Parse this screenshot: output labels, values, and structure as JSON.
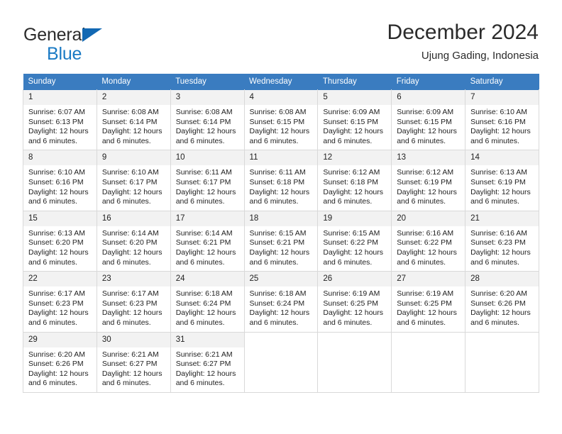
{
  "brand": {
    "line1": "General",
    "line2": "Blue",
    "triangle_color": "#1268b3",
    "blue_text_color": "#1a7ac4"
  },
  "header": {
    "title": "December 2024",
    "subtitle": "Ujung Gading, Indonesia"
  },
  "theme": {
    "header_blue": "#3a7cc0",
    "daynum_bg": "#f2f2f2",
    "grid_border": "#d9d9d9",
    "text": "#222222"
  },
  "columns": [
    "Sunday",
    "Monday",
    "Tuesday",
    "Wednesday",
    "Thursday",
    "Friday",
    "Saturday"
  ],
  "weeks": [
    [
      {
        "day": "1",
        "sunrise": "Sunrise: 6:07 AM",
        "sunset": "Sunset: 6:13 PM",
        "daylight1": "Daylight: 12 hours",
        "daylight2": "and 6 minutes."
      },
      {
        "day": "2",
        "sunrise": "Sunrise: 6:08 AM",
        "sunset": "Sunset: 6:14 PM",
        "daylight1": "Daylight: 12 hours",
        "daylight2": "and 6 minutes."
      },
      {
        "day": "3",
        "sunrise": "Sunrise: 6:08 AM",
        "sunset": "Sunset: 6:14 PM",
        "daylight1": "Daylight: 12 hours",
        "daylight2": "and 6 minutes."
      },
      {
        "day": "4",
        "sunrise": "Sunrise: 6:08 AM",
        "sunset": "Sunset: 6:15 PM",
        "daylight1": "Daylight: 12 hours",
        "daylight2": "and 6 minutes."
      },
      {
        "day": "5",
        "sunrise": "Sunrise: 6:09 AM",
        "sunset": "Sunset: 6:15 PM",
        "daylight1": "Daylight: 12 hours",
        "daylight2": "and 6 minutes."
      },
      {
        "day": "6",
        "sunrise": "Sunrise: 6:09 AM",
        "sunset": "Sunset: 6:15 PM",
        "daylight1": "Daylight: 12 hours",
        "daylight2": "and 6 minutes."
      },
      {
        "day": "7",
        "sunrise": "Sunrise: 6:10 AM",
        "sunset": "Sunset: 6:16 PM",
        "daylight1": "Daylight: 12 hours",
        "daylight2": "and 6 minutes."
      }
    ],
    [
      {
        "day": "8",
        "sunrise": "Sunrise: 6:10 AM",
        "sunset": "Sunset: 6:16 PM",
        "daylight1": "Daylight: 12 hours",
        "daylight2": "and 6 minutes."
      },
      {
        "day": "9",
        "sunrise": "Sunrise: 6:10 AM",
        "sunset": "Sunset: 6:17 PM",
        "daylight1": "Daylight: 12 hours",
        "daylight2": "and 6 minutes."
      },
      {
        "day": "10",
        "sunrise": "Sunrise: 6:11 AM",
        "sunset": "Sunset: 6:17 PM",
        "daylight1": "Daylight: 12 hours",
        "daylight2": "and 6 minutes."
      },
      {
        "day": "11",
        "sunrise": "Sunrise: 6:11 AM",
        "sunset": "Sunset: 6:18 PM",
        "daylight1": "Daylight: 12 hours",
        "daylight2": "and 6 minutes."
      },
      {
        "day": "12",
        "sunrise": "Sunrise: 6:12 AM",
        "sunset": "Sunset: 6:18 PM",
        "daylight1": "Daylight: 12 hours",
        "daylight2": "and 6 minutes."
      },
      {
        "day": "13",
        "sunrise": "Sunrise: 6:12 AM",
        "sunset": "Sunset: 6:19 PM",
        "daylight1": "Daylight: 12 hours",
        "daylight2": "and 6 minutes."
      },
      {
        "day": "14",
        "sunrise": "Sunrise: 6:13 AM",
        "sunset": "Sunset: 6:19 PM",
        "daylight1": "Daylight: 12 hours",
        "daylight2": "and 6 minutes."
      }
    ],
    [
      {
        "day": "15",
        "sunrise": "Sunrise: 6:13 AM",
        "sunset": "Sunset: 6:20 PM",
        "daylight1": "Daylight: 12 hours",
        "daylight2": "and 6 minutes."
      },
      {
        "day": "16",
        "sunrise": "Sunrise: 6:14 AM",
        "sunset": "Sunset: 6:20 PM",
        "daylight1": "Daylight: 12 hours",
        "daylight2": "and 6 minutes."
      },
      {
        "day": "17",
        "sunrise": "Sunrise: 6:14 AM",
        "sunset": "Sunset: 6:21 PM",
        "daylight1": "Daylight: 12 hours",
        "daylight2": "and 6 minutes."
      },
      {
        "day": "18",
        "sunrise": "Sunrise: 6:15 AM",
        "sunset": "Sunset: 6:21 PM",
        "daylight1": "Daylight: 12 hours",
        "daylight2": "and 6 minutes."
      },
      {
        "day": "19",
        "sunrise": "Sunrise: 6:15 AM",
        "sunset": "Sunset: 6:22 PM",
        "daylight1": "Daylight: 12 hours",
        "daylight2": "and 6 minutes."
      },
      {
        "day": "20",
        "sunrise": "Sunrise: 6:16 AM",
        "sunset": "Sunset: 6:22 PM",
        "daylight1": "Daylight: 12 hours",
        "daylight2": "and 6 minutes."
      },
      {
        "day": "21",
        "sunrise": "Sunrise: 6:16 AM",
        "sunset": "Sunset: 6:23 PM",
        "daylight1": "Daylight: 12 hours",
        "daylight2": "and 6 minutes."
      }
    ],
    [
      {
        "day": "22",
        "sunrise": "Sunrise: 6:17 AM",
        "sunset": "Sunset: 6:23 PM",
        "daylight1": "Daylight: 12 hours",
        "daylight2": "and 6 minutes."
      },
      {
        "day": "23",
        "sunrise": "Sunrise: 6:17 AM",
        "sunset": "Sunset: 6:23 PM",
        "daylight1": "Daylight: 12 hours",
        "daylight2": "and 6 minutes."
      },
      {
        "day": "24",
        "sunrise": "Sunrise: 6:18 AM",
        "sunset": "Sunset: 6:24 PM",
        "daylight1": "Daylight: 12 hours",
        "daylight2": "and 6 minutes."
      },
      {
        "day": "25",
        "sunrise": "Sunrise: 6:18 AM",
        "sunset": "Sunset: 6:24 PM",
        "daylight1": "Daylight: 12 hours",
        "daylight2": "and 6 minutes."
      },
      {
        "day": "26",
        "sunrise": "Sunrise: 6:19 AM",
        "sunset": "Sunset: 6:25 PM",
        "daylight1": "Daylight: 12 hours",
        "daylight2": "and 6 minutes."
      },
      {
        "day": "27",
        "sunrise": "Sunrise: 6:19 AM",
        "sunset": "Sunset: 6:25 PM",
        "daylight1": "Daylight: 12 hours",
        "daylight2": "and 6 minutes."
      },
      {
        "day": "28",
        "sunrise": "Sunrise: 6:20 AM",
        "sunset": "Sunset: 6:26 PM",
        "daylight1": "Daylight: 12 hours",
        "daylight2": "and 6 minutes."
      }
    ],
    [
      {
        "day": "29",
        "sunrise": "Sunrise: 6:20 AM",
        "sunset": "Sunset: 6:26 PM",
        "daylight1": "Daylight: 12 hours",
        "daylight2": "and 6 minutes."
      },
      {
        "day": "30",
        "sunrise": "Sunrise: 6:21 AM",
        "sunset": "Sunset: 6:27 PM",
        "daylight1": "Daylight: 12 hours",
        "daylight2": "and 6 minutes."
      },
      {
        "day": "31",
        "sunrise": "Sunrise: 6:21 AM",
        "sunset": "Sunset: 6:27 PM",
        "daylight1": "Daylight: 12 hours",
        "daylight2": "and 6 minutes."
      },
      {
        "day": "",
        "sunrise": "",
        "sunset": "",
        "daylight1": "",
        "daylight2": ""
      },
      {
        "day": "",
        "sunrise": "",
        "sunset": "",
        "daylight1": "",
        "daylight2": ""
      },
      {
        "day": "",
        "sunrise": "",
        "sunset": "",
        "daylight1": "",
        "daylight2": ""
      },
      {
        "day": "",
        "sunrise": "",
        "sunset": "",
        "daylight1": "",
        "daylight2": ""
      }
    ]
  ]
}
